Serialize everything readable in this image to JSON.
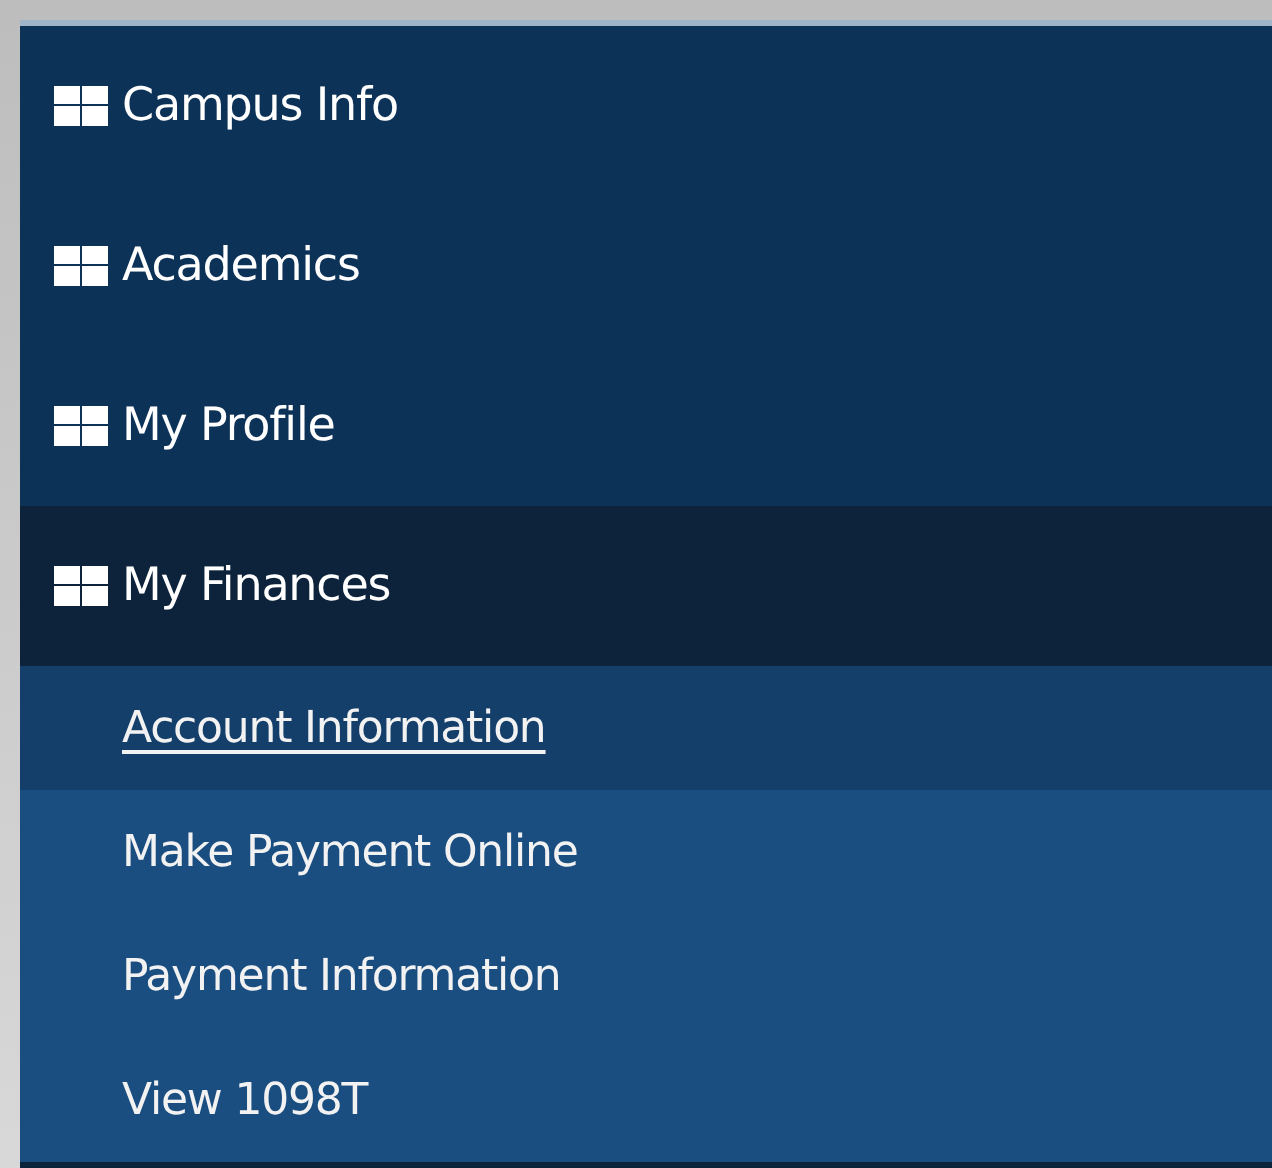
{
  "menu": [
    {
      "label": "Campus Info",
      "expanded": false
    },
    {
      "label": "Academics",
      "expanded": false
    },
    {
      "label": "My Profile",
      "expanded": false
    },
    {
      "label": "My Finances",
      "expanded": true,
      "children": [
        {
          "label": "Account Information",
          "selected": true
        },
        {
          "label": "Make Payment Online",
          "selected": false
        },
        {
          "label": "Payment Information",
          "selected": false
        },
        {
          "label": "View 1098T",
          "selected": false
        }
      ]
    }
  ]
}
